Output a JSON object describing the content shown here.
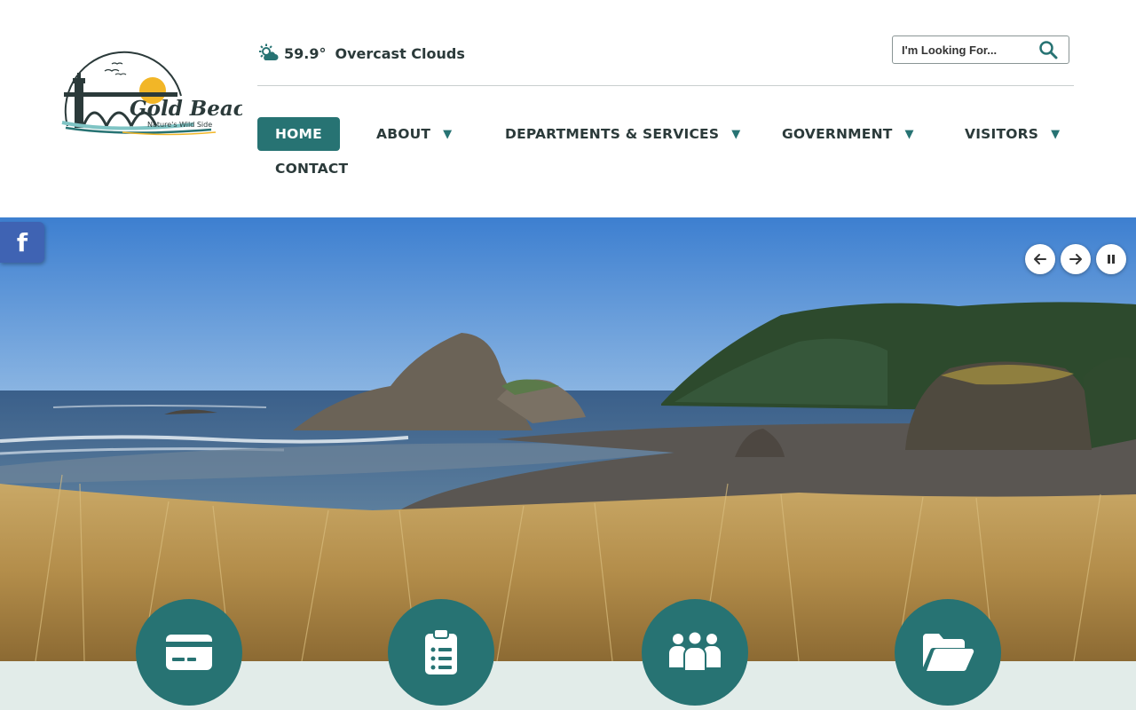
{
  "site": {
    "name": "Gold Beach",
    "tagline": "Nature's Wild Side"
  },
  "weather": {
    "temperature": "59.9°",
    "condition": "Overcast Clouds",
    "icon": "partly-cloudy-icon"
  },
  "search": {
    "placeholder": "I'm Looking For...",
    "icon": "search-icon"
  },
  "nav": {
    "items": [
      {
        "label": "HOME",
        "active": true,
        "has_dropdown": false
      },
      {
        "label": "ABOUT",
        "active": false,
        "has_dropdown": true
      },
      {
        "label": "DEPARTMENTS & SERVICES",
        "active": false,
        "has_dropdown": true
      },
      {
        "label": "GOVERNMENT",
        "active": false,
        "has_dropdown": true
      },
      {
        "label": "VISITORS",
        "active": false,
        "has_dropdown": true
      },
      {
        "label": "CONTACT",
        "active": false,
        "has_dropdown": false
      }
    ],
    "caret": "▼"
  },
  "social": {
    "facebook_icon": "facebook-icon",
    "facebook_glyph": "f"
  },
  "slideshow": {
    "controls": [
      "previous-arrow-icon",
      "next-arrow-icon",
      "pause-icon"
    ]
  },
  "quick_links": {
    "icons": [
      "credit-card-icon",
      "clipboard-list-icon",
      "people-group-icon",
      "folder-open-icon"
    ]
  },
  "colors": {
    "brand_teal": "#277373",
    "band_background": "#e2ece9",
    "facebook_blue": "#3f63b3"
  }
}
